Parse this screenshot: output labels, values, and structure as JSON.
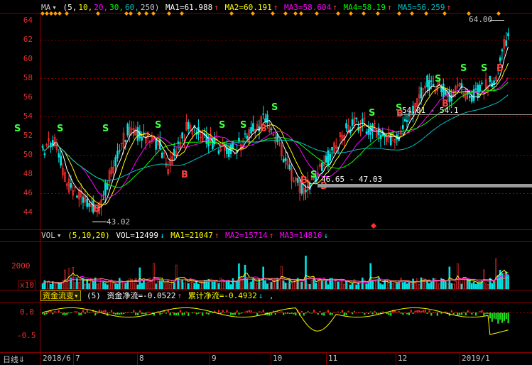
{
  "main_header": {
    "indicator": "MA",
    "dropdown": "▾",
    "params_open": "(5,",
    "p1": "10,",
    "p2": "20,",
    "p3": "30,",
    "p4": "60,",
    "p5": "250)",
    "ma1": "MA1=61.988",
    "ma2": "MA2=60.191",
    "ma3": "MA3=58.604",
    "ma4": "MA4=58.19",
    "ma5": "MA5=56.259",
    "arrow_up": "↑"
  },
  "price_axis": [
    "64",
    "62",
    "60",
    "58",
    "56",
    "54",
    "52",
    "50",
    "48",
    "46",
    "44"
  ],
  "annotations": {
    "high": "64.00",
    "low": "43.02",
    "range1": "46.65 - 47.03",
    "range2": "54.01 - 54.1",
    "buy": "B",
    "sell": "S"
  },
  "vol_header": {
    "indicator": "VOL",
    "dropdown": "▾",
    "params": "(5,10,20)",
    "vol": "VOL=12499",
    "ma1": "MA1=21047",
    "ma2": "MA2=15714",
    "ma3": "MA3=14816"
  },
  "vol_axis": {
    "top": "2000",
    "unit": "x10"
  },
  "fund_header": {
    "tab": "资金流变",
    "params": "(5)",
    "net": "资金净流=-0.0522",
    "cum": "累计净流=-0.4932",
    "tail": ","
  },
  "fund_axis": [
    "0.0",
    "-0.5"
  ],
  "bottom": {
    "period": "日线",
    "period_arrow": "⇓",
    "months": [
      "2018/6",
      "7",
      "8",
      "9",
      "10",
      "11",
      "12",
      "2019/1"
    ]
  },
  "colors": {
    "up": "#ff3030",
    "down": "#00e5e5",
    "ma1": "#ffffff",
    "ma2": "#ffff00",
    "ma3": "#ff00ff",
    "ma4": "#00ff00",
    "ma5": "#00bfbf",
    "grid": "#8b0000"
  }
}
